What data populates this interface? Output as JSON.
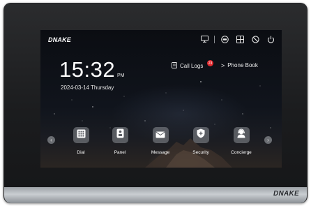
{
  "device": {
    "brand": "DNAKE",
    "frame_logo": "DNAKE"
  },
  "status_bar": {
    "icons": [
      "monitor-icon",
      "cctv-icon",
      "split-screen-icon",
      "do-not-disturb-icon",
      "power-icon"
    ]
  },
  "clock": {
    "time": "15:32",
    "meridiem": "PM",
    "date": "2024-03-14 Thursday"
  },
  "shortcuts": {
    "call_logs_label": "Call Logs",
    "call_logs_badge": "23",
    "phone_book_label": "Phone Book",
    "phone_book_prefix": ">"
  },
  "apps": [
    {
      "label": "Dial",
      "icon": "dialpad-icon"
    },
    {
      "label": "Panel",
      "icon": "door-panel-icon"
    },
    {
      "label": "Message",
      "icon": "envelope-icon"
    },
    {
      "label": "Security",
      "icon": "shield-plus-icon"
    },
    {
      "label": "Concierge",
      "icon": "concierge-icon"
    }
  ],
  "nav": {
    "prev": "‹",
    "next": "›"
  },
  "colors": {
    "badge": "#e3292e",
    "tile": "#8c8f96",
    "frame": "#1b1c1e",
    "strip": "#c9cdd1"
  }
}
